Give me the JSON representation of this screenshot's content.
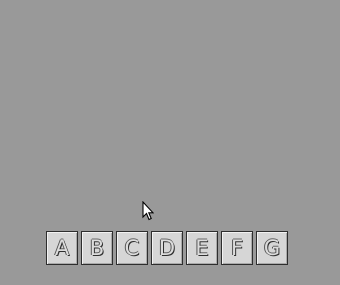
{
  "buttons": [
    {
      "label": "A"
    },
    {
      "label": "B"
    },
    {
      "label": "C"
    },
    {
      "label": "D"
    },
    {
      "label": "E"
    },
    {
      "label": "F"
    },
    {
      "label": "G"
    }
  ],
  "colors": {
    "background": "#999999",
    "button_face": "#d6d6d6",
    "button_border": "#2e2e2e"
  },
  "icons": {
    "cursor": "arrow-cursor-icon"
  }
}
